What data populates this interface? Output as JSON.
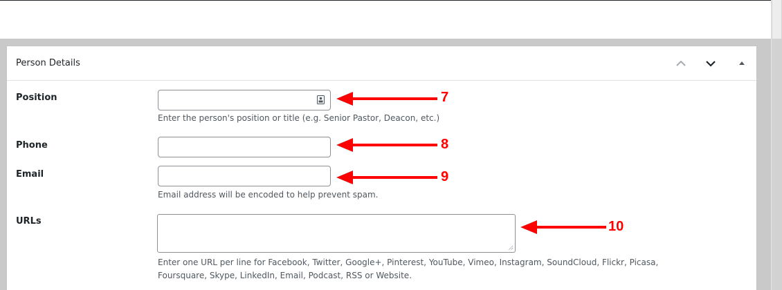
{
  "postbox": {
    "title": "Person Details",
    "controls": {
      "move_up_icon": "chevron-up",
      "move_down_icon": "chevron-down",
      "toggle_icon": "triangle-up"
    }
  },
  "fields": {
    "position": {
      "label": "Position",
      "value": "",
      "description": "Enter the person's position or title (e.g. Senior Pastor, Deacon, etc.)"
    },
    "phone": {
      "label": "Phone",
      "value": ""
    },
    "email": {
      "label": "Email",
      "value": "",
      "description": "Email address will be encoded to help prevent spam."
    },
    "urls": {
      "label": "URLs",
      "value": "",
      "description_line1": "Enter one URL per line for Facebook, Twitter, Google+, Pinterest, YouTube, Vimeo, Instagram, SoundCloud, Flickr, Picasa,",
      "description_line2": "Foursquare, Skype, LinkedIn, Email, Podcast, RSS or Website."
    }
  },
  "annotations": {
    "position_number": "7",
    "phone_number": "8",
    "email_number": "9",
    "urls_number": "10",
    "arrow_color": "#ff0000"
  }
}
